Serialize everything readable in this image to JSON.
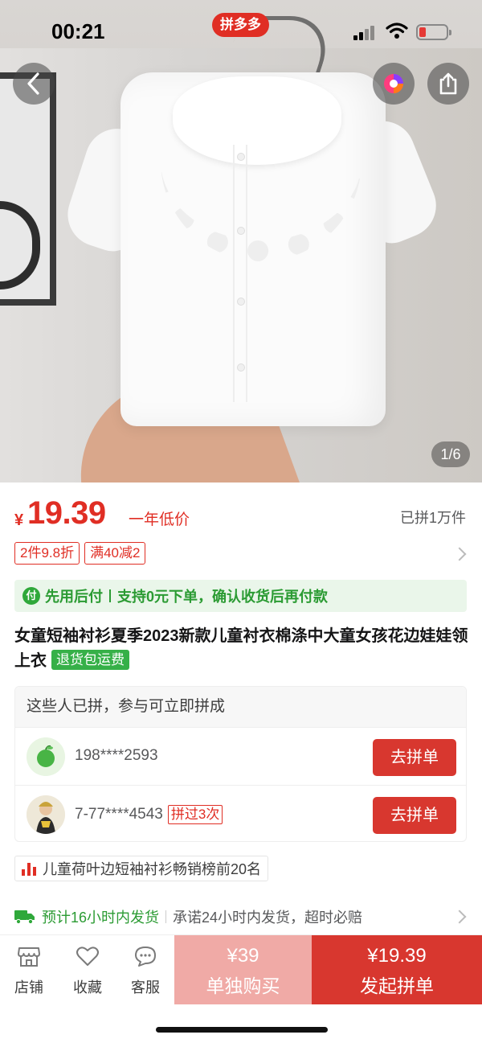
{
  "status_bar": {
    "time": "00:21",
    "app_badge": "拼多多"
  },
  "hero": {
    "page_indicator": "1/6"
  },
  "price": {
    "currency": "¥",
    "value": "19.39",
    "tag": "一年低价",
    "sold": "已拼1万件"
  },
  "coupons": [
    "2件9.8折",
    "满40减2"
  ],
  "pay_later": {
    "icon_text": "付",
    "title": "先用后付",
    "desc": "支持0元下单，确认收货后再付款"
  },
  "product": {
    "title": "女童短袖衬衫夏季2023新款儿童衬衣棉涤中大童女孩花边娃娃领上衣",
    "badge": "退货包运费"
  },
  "group_buy": {
    "header": "这些人已拼，参与可立即拼成",
    "rows": [
      {
        "name": "198****2593",
        "tag": "",
        "button": "去拼单"
      },
      {
        "name": "7-77****4543",
        "tag": "拼过3次",
        "button": "去拼单"
      }
    ]
  },
  "rank": {
    "text": "儿童荷叶边短袖衬衫畅销榜前20名"
  },
  "shipping": {
    "title": "预计16小时内发货",
    "desc": "承诺24小时内发货，超时必赔"
  },
  "bottom_bar": {
    "nav": [
      {
        "label": "店铺",
        "icon": "store-icon"
      },
      {
        "label": "收藏",
        "icon": "heart-icon"
      },
      {
        "label": "客服",
        "icon": "chat-icon"
      }
    ],
    "solo": {
      "price": "¥39",
      "label": "单独购买"
    },
    "group": {
      "price": "¥19.39",
      "label": "发起拼单"
    }
  },
  "colors": {
    "brand": "#e02e24",
    "green": "#2b9b33",
    "button_red": "#d8372f",
    "solo_pink": "#f0aaa6"
  }
}
